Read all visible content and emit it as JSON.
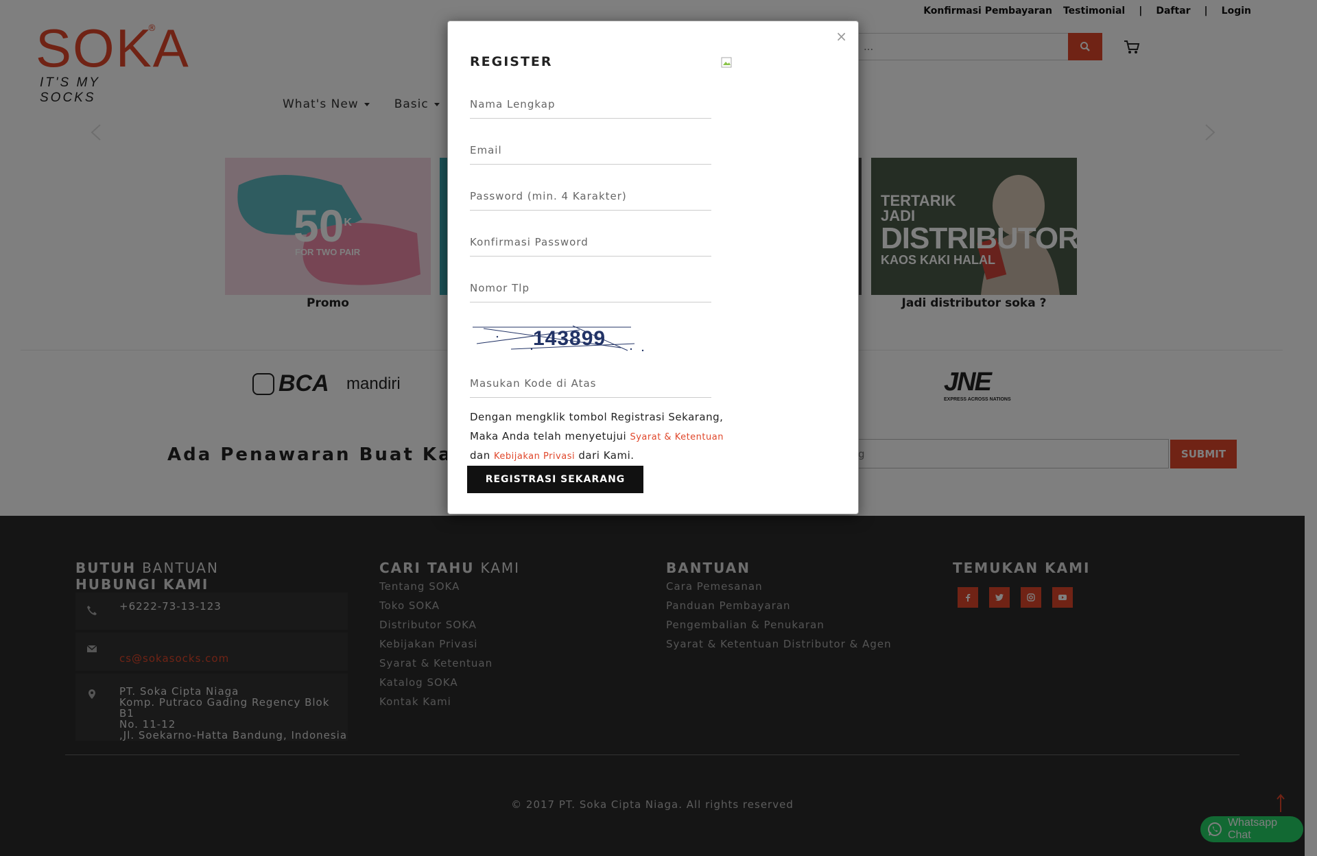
{
  "toplinks": {
    "konfirmasi": "Konfirmasi Pembayaran",
    "testimonial": "Testimonial",
    "sep1": "|",
    "daftar": "Daftar",
    "sep2": "|",
    "login": "Login"
  },
  "logo": {
    "word": "SOKA",
    "tagline": "IT'S MY SOCKS",
    "reg": "®"
  },
  "search": {
    "placeholder": "..."
  },
  "nav": {
    "items": [
      {
        "label": "What's New"
      },
      {
        "label": "Basic"
      }
    ]
  },
  "promos": [
    {
      "label": "Promo",
      "overlay_big": "50",
      "overlay_k": "K",
      "overlay_small": "FOR TWO PAIR"
    },
    {
      "label": "Jadi distributor soka ?",
      "line1": "TERTARIK",
      "line2": "JADI",
      "line3": "DISTRIBUTOR",
      "line4": "KAOS KAKI HALAL"
    }
  ],
  "payment": {
    "bca": "BCA",
    "mandiri": "mandiri",
    "jne": "JNE",
    "jne_sub": "EXPRESS ACROSS NATIONS"
  },
  "offer": {
    "title": "Ada Penawaran Buat Kamu",
    "input_value": "g",
    "submit": "SUBMIT"
  },
  "footer": {
    "help_head_bold": "BUTUH",
    "help_head_thin": "BANTUAN",
    "help_head2": "HUBUNGI KAMI",
    "phone": "+6222-73-13-123",
    "email": "cs@sokasocks.com",
    "address_lines": [
      "PT. Soka Cipta Niaga",
      "Komp. Putraco Gading Regency Blok B1",
      "No. 11-12",
      ",Jl. Soekarno-Hatta Bandung, Indonesia"
    ],
    "about_head_bold": "CARI TAHU",
    "about_head_thin": "KAMI",
    "about_links": [
      "Tentang SOKA",
      "Toko SOKA",
      "Distributor SOKA",
      "Kebijakan Privasi",
      "Syarat & Ketentuan",
      "Katalog SOKA",
      "Kontak Kami"
    ],
    "help2_head": "BANTUAN",
    "help2_links": [
      "Cara Pemesanan",
      "Panduan Pembayaran",
      "Pengembalian & Penukaran",
      "Syarat & Ketentuan Distributor & Agen"
    ],
    "social_head": "TEMUKAN KAMI",
    "copyright": "© 2017 PT. Soka Cipta Niaga. All rights reserved"
  },
  "whatsapp": {
    "label": "Whatsapp Chat"
  },
  "modal": {
    "close": "×",
    "title": "REGISTER",
    "fields": {
      "name": "Nama Lengkap",
      "email": "Email",
      "password": "Password (min. 4 Karakter)",
      "confirm": "Konfirmasi Password",
      "phone": "Nomor Tlp",
      "captcha_code": "Masukan Kode di Atas"
    },
    "captcha_text": "143899",
    "terms_1": "Dengan mengklik tombol Registrasi Sekarang, Maka Anda telah menyetujui",
    "terms_link1": "Syarat & Ketentuan",
    "terms_2": "dan",
    "terms_link2": "Kebijakan Privasi",
    "terms_3": "dari Kami.",
    "submit": "REGISTRASI SEKARANG"
  },
  "colors": {
    "accent": "#e0472b",
    "footer_bg": "#2b2b2b",
    "whatsapp": "#25d366"
  }
}
